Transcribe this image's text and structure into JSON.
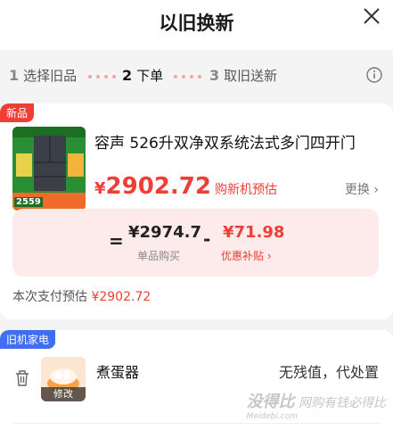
{
  "header": {
    "title": "以旧换新"
  },
  "steps": [
    {
      "num": "1",
      "label": "选择旧品"
    },
    {
      "num": "2",
      "label": "下单"
    },
    {
      "num": "3",
      "label": "取旧送新"
    }
  ],
  "new_product": {
    "tag": "新品",
    "name": "容声 526升双净双系统法式多门四开门",
    "image_text": "2559",
    "price_symbol": "¥",
    "price": "2902.72",
    "price_label": "购新机预估",
    "change_label": "更换 ›",
    "calc": {
      "unit_price": "¥2974.7",
      "unit_label": "单品购买",
      "subsidy": "¥71.98",
      "subsidy_label": "优惠补贴 ›"
    },
    "pay_label": "本次支付预估",
    "pay_amount": "¥2902.72"
  },
  "old_appliance": {
    "tag": "旧机家电",
    "name": "煮蛋器",
    "edit_label": "修改",
    "value_text": "无残值，代处置"
  },
  "watermark": {
    "brand": "没得比",
    "slogan": "网购有钱必得比",
    "url": "Meidebi.com"
  },
  "colors": {
    "accent": "#f03e36",
    "old_tag": "#3f6ff0",
    "calc_bg": "#fdeaea"
  }
}
